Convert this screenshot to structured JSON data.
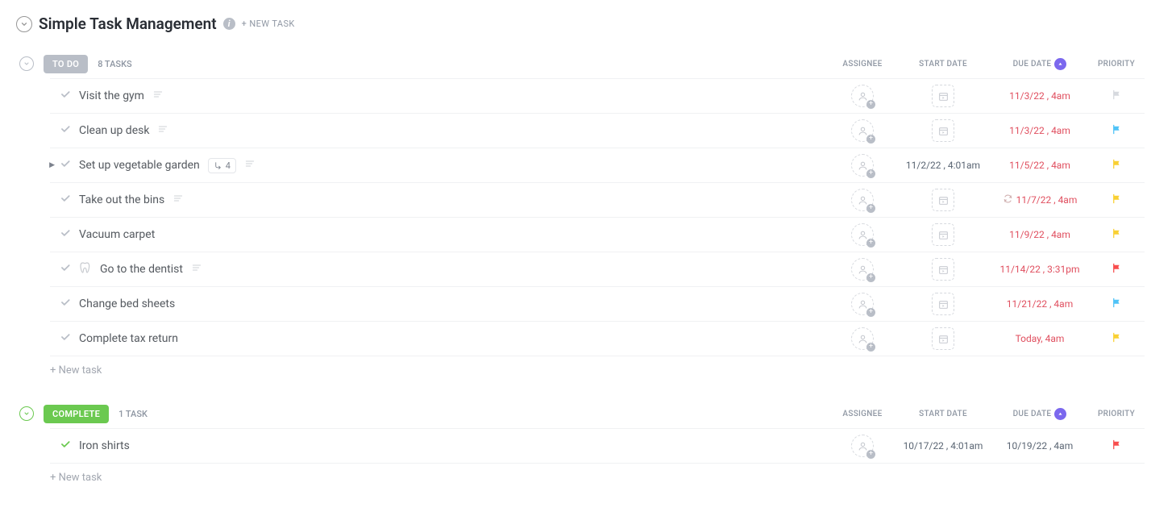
{
  "header": {
    "title": "Simple Task Management",
    "new_task_label": "+ NEW TASK"
  },
  "columns": {
    "assignee": "ASSIGNEE",
    "start_date": "START DATE",
    "due_date": "DUE DATE",
    "priority": "PRIORITY"
  },
  "groups": [
    {
      "id": "todo",
      "status_label": "TO DO",
      "status_color": "#b9bec7",
      "count_label": "8 TASKS",
      "tasks": [
        {
          "title": "Visit the gym",
          "has_expand": false,
          "has_subtasks": false,
          "subtask_count": "",
          "has_tooth": false,
          "has_more": true,
          "start": "",
          "due": "11/3/22 , 4am",
          "recurring": false,
          "flag": "none"
        },
        {
          "title": "Clean up desk",
          "has_expand": false,
          "has_subtasks": false,
          "subtask_count": "",
          "has_tooth": false,
          "has_more": true,
          "start": "",
          "due": "11/3/22 , 4am",
          "recurring": false,
          "flag": "blue"
        },
        {
          "title": "Set up vegetable garden",
          "has_expand": true,
          "has_subtasks": true,
          "subtask_count": "4",
          "has_tooth": false,
          "has_more": true,
          "start": "11/2/22 , 4:01am",
          "due": "11/5/22 , 4am",
          "recurring": false,
          "flag": "yellow"
        },
        {
          "title": "Take out the bins",
          "has_expand": false,
          "has_subtasks": false,
          "subtask_count": "",
          "has_tooth": false,
          "has_more": true,
          "start": "",
          "due": "11/7/22 , 4am",
          "recurring": true,
          "flag": "yellow"
        },
        {
          "title": "Vacuum carpet",
          "has_expand": false,
          "has_subtasks": false,
          "subtask_count": "",
          "has_tooth": false,
          "has_more": false,
          "start": "",
          "due": "11/9/22 , 4am",
          "recurring": false,
          "flag": "yellow"
        },
        {
          "title": "Go to the dentist",
          "has_expand": false,
          "has_subtasks": false,
          "subtask_count": "",
          "has_tooth": true,
          "has_more": true,
          "start": "",
          "due": "11/14/22 , 3:31pm",
          "recurring": false,
          "flag": "red"
        },
        {
          "title": "Change bed sheets",
          "has_expand": false,
          "has_subtasks": false,
          "subtask_count": "",
          "has_tooth": false,
          "has_more": false,
          "start": "",
          "due": "11/21/22 , 4am",
          "recurring": false,
          "flag": "blue"
        },
        {
          "title": "Complete tax return",
          "has_expand": false,
          "has_subtasks": false,
          "subtask_count": "",
          "has_tooth": false,
          "has_more": false,
          "start": "",
          "due": "Today, 4am",
          "recurring": false,
          "flag": "yellow"
        }
      ],
      "new_task_label": "+ New task"
    },
    {
      "id": "complete",
      "status_label": "COMPLETE",
      "status_color": "#6bc950",
      "count_label": "1 TASK",
      "tasks": [
        {
          "title": "Iron shirts",
          "has_expand": false,
          "has_subtasks": false,
          "subtask_count": "",
          "has_tooth": false,
          "has_more": false,
          "start": "10/17/22 , 4:01am",
          "due": "10/19/22 , 4am",
          "recurring": false,
          "flag": "red",
          "done": true
        }
      ],
      "new_task_label": "+ New task"
    }
  ]
}
